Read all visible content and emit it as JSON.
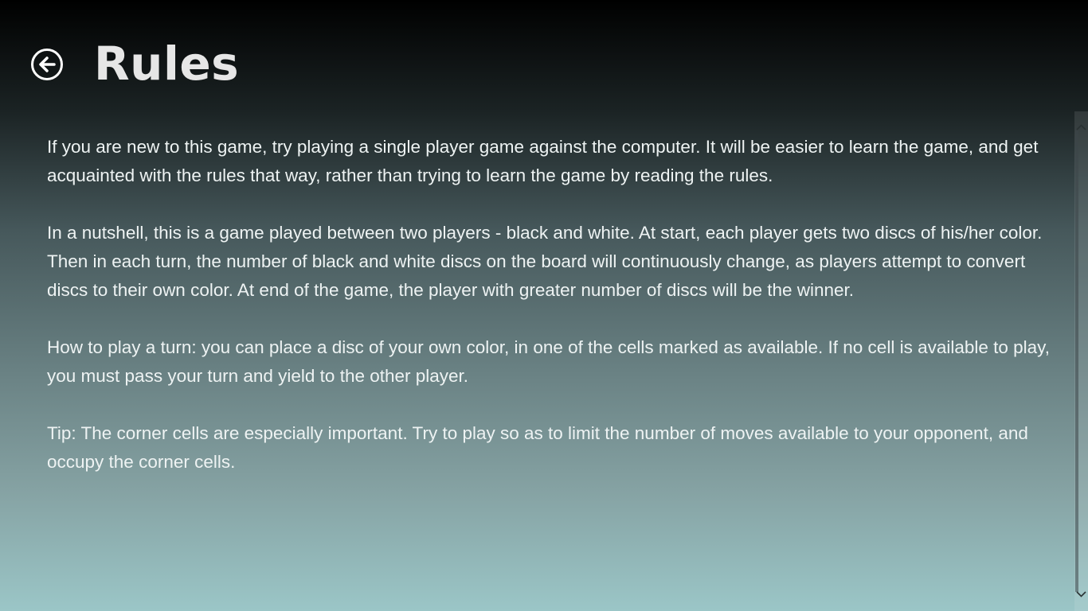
{
  "header": {
    "title": "Rules",
    "back_icon": "back-arrow-circle-icon"
  },
  "content": {
    "paragraphs": [
      "If you are new to this game, try playing a single player game against the computer. It will be easier to learn the game, and get acquainted with the rules that way, rather than trying to learn the game by reading the rules.",
      "In a nutshell, this is a game played between two players - black and white. At start, each player gets two discs of his/her color. Then in each turn, the number of black and white discs on the board will continuously change, as players attempt to convert discs to their own color. At end of the game, the player with greater number of discs will be the winner.",
      "How to play a turn: you can place a disc of your own color, in one of the cells marked as available. If no cell is available to play, you must pass your turn and yield to the other player.",
      "Tip: The corner cells are especially important. Try to play so as to limit the number of moves available to your opponent, and occupy the corner cells."
    ]
  },
  "colors": {
    "background_top": "#000000",
    "background_bottom": "#9bc6c7",
    "title_text": "#e6e6e6",
    "body_text": "#eef3f3"
  }
}
